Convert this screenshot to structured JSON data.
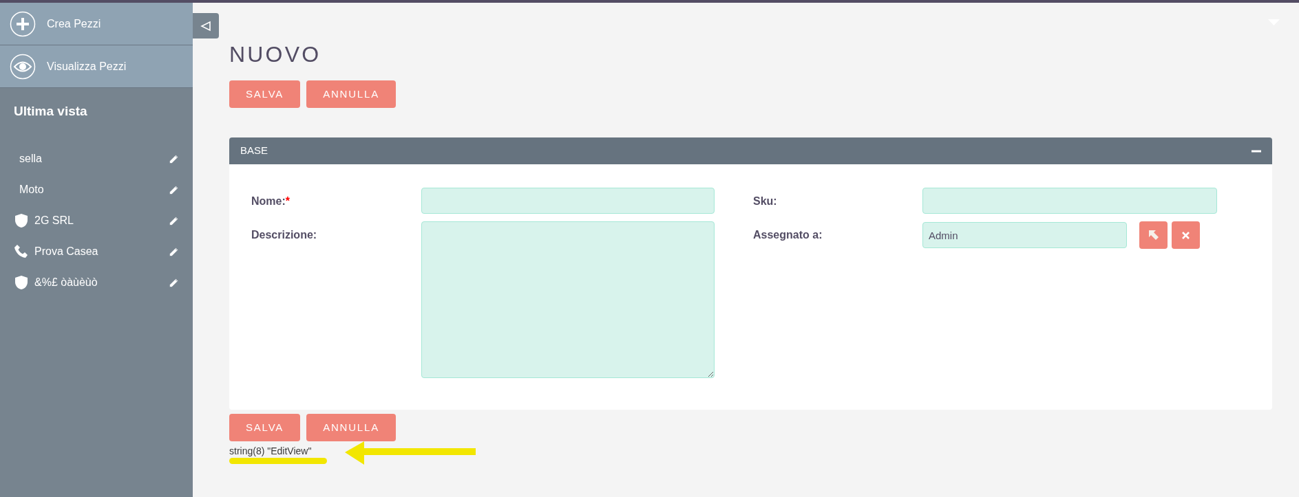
{
  "sidebar": {
    "actions": [
      {
        "label": "Crea Pezzi",
        "kind": "create"
      },
      {
        "label": "Visualizza Pezzi",
        "kind": "view"
      }
    ],
    "recent_title": "Ultima vista",
    "recent": [
      {
        "label": "sella",
        "kind": "plain"
      },
      {
        "label": "Moto",
        "kind": "plain"
      },
      {
        "label": "2G SRL",
        "kind": "account"
      },
      {
        "label": "Prova Casea",
        "kind": "call"
      },
      {
        "label": "&%£ òàùèùò",
        "kind": "account"
      }
    ]
  },
  "page_title": "NUOVO",
  "buttons_top": [
    "SALVA",
    "ANNULLA"
  ],
  "panel": {
    "title": "BASE",
    "expanded": true,
    "required_mark": "*",
    "rows": [
      [
        {
          "label": "Nome:",
          "required": true,
          "kind": "text"
        },
        {
          "label": "Sku:",
          "required": false,
          "kind": "text"
        }
      ],
      [
        {
          "label": "Descrizione:",
          "required": false,
          "kind": "textarea"
        },
        {
          "label": "Assegnato a:",
          "required": false,
          "kind": "relate",
          "value": "Admin"
        }
      ]
    ]
  },
  "buttons_bottom": [
    "SALVA",
    "ANNULLA"
  ],
  "debug_output": "string(8) \"EditView\""
}
